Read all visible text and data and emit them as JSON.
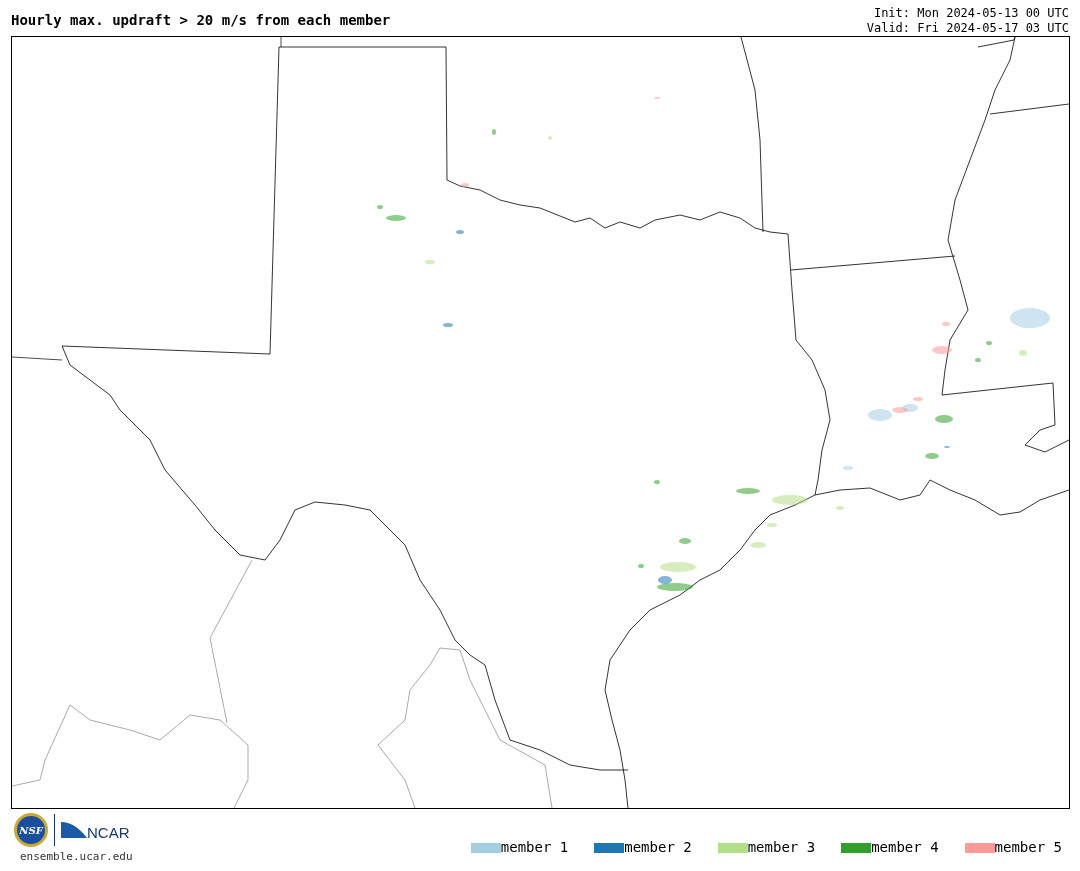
{
  "title": "Hourly max. updraft > 20 m/s from each member",
  "init": "Init: Mon 2024-05-13 00 UTC",
  "valid": "Valid: Fri 2024-05-17 03 UTC",
  "logos": {
    "nsf": "NSF",
    "ncar": "NCAR"
  },
  "site": "ensemble.ucar.edu",
  "legend": [
    {
      "label": "member 1",
      "color": "#a6cee3"
    },
    {
      "label": "member 2",
      "color": "#1f78b4"
    },
    {
      "label": "member 3",
      "color": "#b2df8a"
    },
    {
      "label": "member 4",
      "color": "#33a02c"
    },
    {
      "label": "member 5",
      "color": "#fb9a99"
    }
  ]
}
